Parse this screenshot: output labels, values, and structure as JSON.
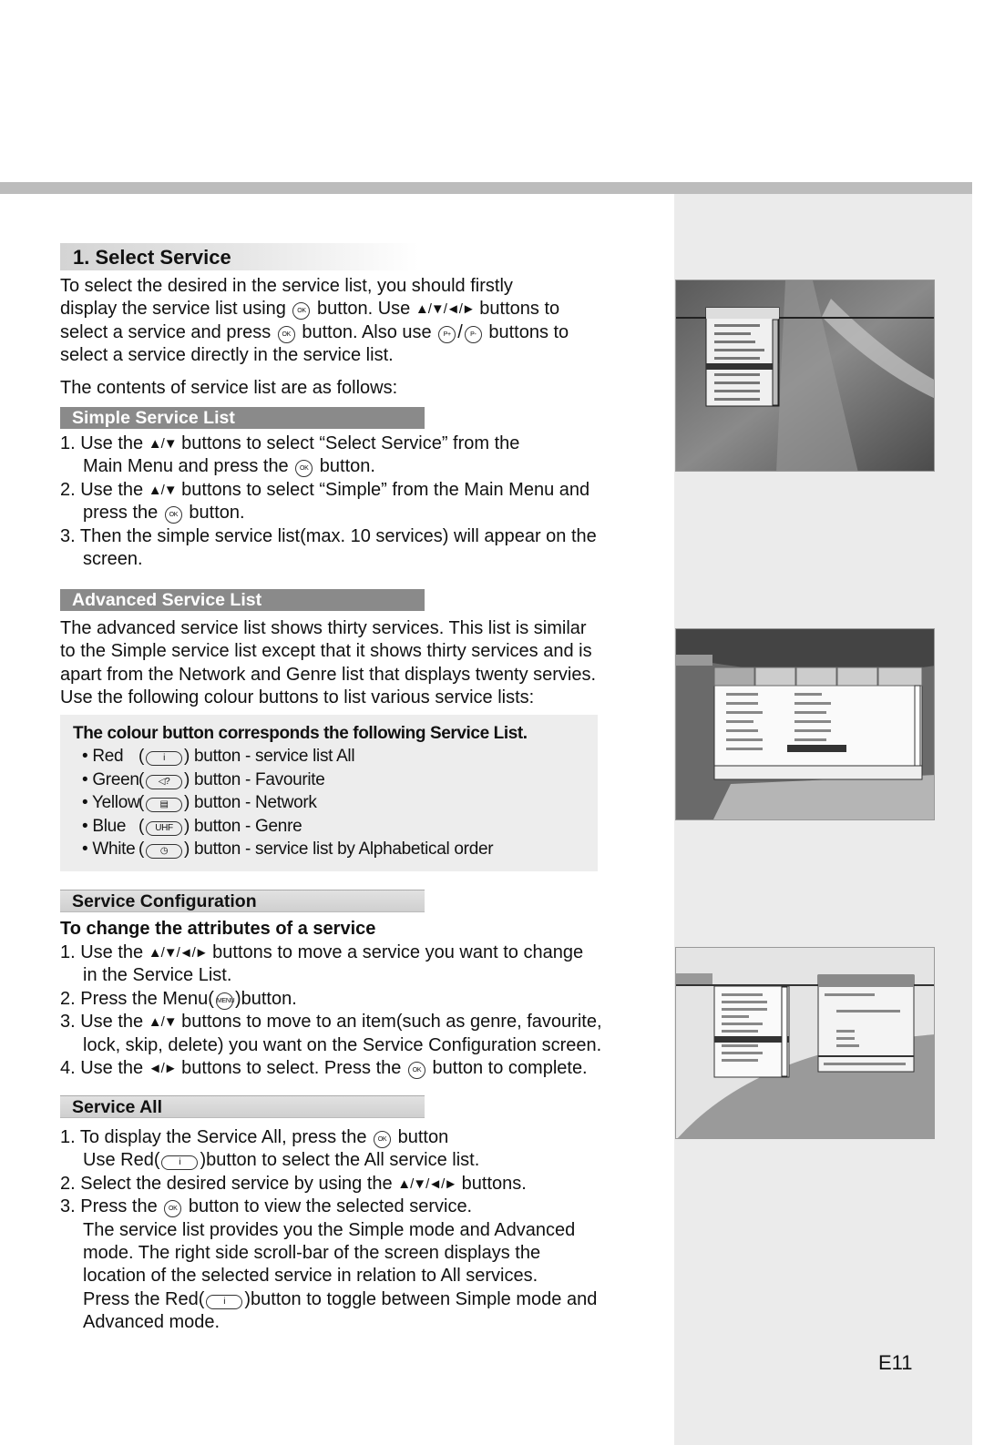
{
  "page_number": "E11",
  "title": "1. Select Service",
  "intro": [
    [
      "To select the desired in the service list, you should firstly"
    ],
    [
      "display the service list using ",
      {
        "icon": "ok-button-icon",
        "label": "OK"
      },
      " button. Use ",
      {
        "arrows": "▲/▼/◄/►"
      },
      " buttons to"
    ],
    [
      "select a service and press ",
      {
        "icon": "ok-button-icon",
        "label": "OK"
      },
      " button. Also use ",
      {
        "icon": "p-plus-button-icon",
        "label": "P+"
      },
      "/",
      {
        "icon": "p-minus-button-icon",
        "label": "P-"
      },
      " buttons to"
    ],
    [
      "select a service directly in the service list."
    ]
  ],
  "contents_line": "The contents of service list are as follows:",
  "simple": {
    "heading": "Simple Service List",
    "lines": [
      [
        "1. Use the ",
        {
          "arrows": "▲/▼"
        },
        " buttons to select “Select Service” from the"
      ],
      {
        "indent": true,
        "segs": [
          "Main Menu and press the ",
          {
            "icon": "ok-button-icon",
            "label": "OK"
          },
          " button."
        ]
      },
      [
        "2. Use the ",
        {
          "arrows": "▲/▼"
        },
        " buttons to select “Simple” from the Main Menu and"
      ],
      {
        "indent": true,
        "segs": [
          "press the ",
          {
            "icon": "ok-button-icon",
            "label": "OK"
          },
          " button."
        ]
      },
      [
        "3. Then the simple service list(max. 10 services) will appear on the"
      ],
      {
        "indent": true,
        "segs": [
          "screen."
        ]
      }
    ]
  },
  "advanced": {
    "heading": "Advanced Service List",
    "lines": [
      [
        "The advanced service list shows thirty services. This list is similar"
      ],
      [
        "to the Simple service list except that it shows thirty services and is"
      ],
      [
        "apart from the Network and Genre list that displays twenty servies."
      ],
      [
        "Use the following colour buttons to list various service lists:"
      ]
    ]
  },
  "colour_box": {
    "title": "The colour button corresponds the following Service List.",
    "items": [
      {
        "color": "Red",
        "icon": "info-button-icon",
        "glyph": "i",
        "desc": "button - service list All"
      },
      {
        "color": "Green",
        "icon": "audio-button-icon",
        "glyph": "◁?",
        "desc": "button - Favourite"
      },
      {
        "color": "Yellow",
        "icon": "teletext-button-icon",
        "glyph": "▤",
        "desc": "button - Network"
      },
      {
        "color": "Blue",
        "icon": "uhf-button-icon",
        "glyph": "UHF",
        "desc": "button - Genre"
      },
      {
        "color": "White",
        "icon": "clock-button-icon",
        "glyph": "◷",
        "desc": "button - service list by Alphabetical order"
      }
    ]
  },
  "config": {
    "heading": "Service Configuration",
    "subheading": "To change the attributes of a service",
    "lines": [
      [
        "1. Use the ",
        {
          "arrows": "▲/▼/◄/►"
        },
        " buttons to move a service you want to change"
      ],
      {
        "indent": true,
        "segs": [
          "in the Service List."
        ]
      },
      [
        "2. Press the Menu(",
        {
          "icon": "menu-button-icon",
          "label": "MENU"
        },
        ")button."
      ],
      [
        "3. Use the ",
        {
          "arrows": "▲/▼"
        },
        " buttons to move to an item(such as genre, favourite,"
      ],
      {
        "indent": true,
        "segs": [
          "lock, skip, delete) you want on the Service Configuration screen."
        ]
      },
      [
        "4. Use the ",
        {
          "arrows": "◄/►"
        },
        " buttons to select. Press the ",
        {
          "icon": "ok-button-icon",
          "label": "OK"
        },
        " button to complete."
      ]
    ]
  },
  "service_all": {
    "heading": "Service All",
    "lines": [
      [
        "1. To display the Service All, press the ",
        {
          "icon": "ok-button-icon",
          "label": "OK"
        },
        " button"
      ],
      {
        "indent": true,
        "segs": [
          "Use Red(",
          {
            "oval": "info-button-icon",
            "label": "i"
          },
          ")button to select the All service list."
        ]
      },
      [
        "2. Select the desired service by using the ",
        {
          "arrows": "▲/▼/◄/►"
        },
        " buttons."
      ],
      [
        "3. Press the ",
        {
          "icon": "ok-button-icon",
          "label": "OK"
        },
        " button to view the selected service."
      ],
      {
        "indent": true,
        "segs": [
          "The service list provides you the Simple mode and Advanced"
        ]
      },
      {
        "indent": true,
        "segs": [
          "mode. The right side scroll-bar of the screen displays the"
        ]
      },
      {
        "indent": true,
        "segs": [
          "location of the selected service in relation to All services."
        ]
      },
      {
        "indent": true,
        "segs": [
          "Press the Red(",
          {
            "oval": "info-button-icon",
            "label": "i"
          },
          ")button to toggle between Simple mode and"
        ]
      },
      {
        "indent": true,
        "segs": [
          "Advanced mode."
        ]
      }
    ]
  },
  "screenshots": [
    "simple-service-list-screenshot",
    "advanced-service-list-screenshot",
    "service-configuration-screenshot"
  ]
}
